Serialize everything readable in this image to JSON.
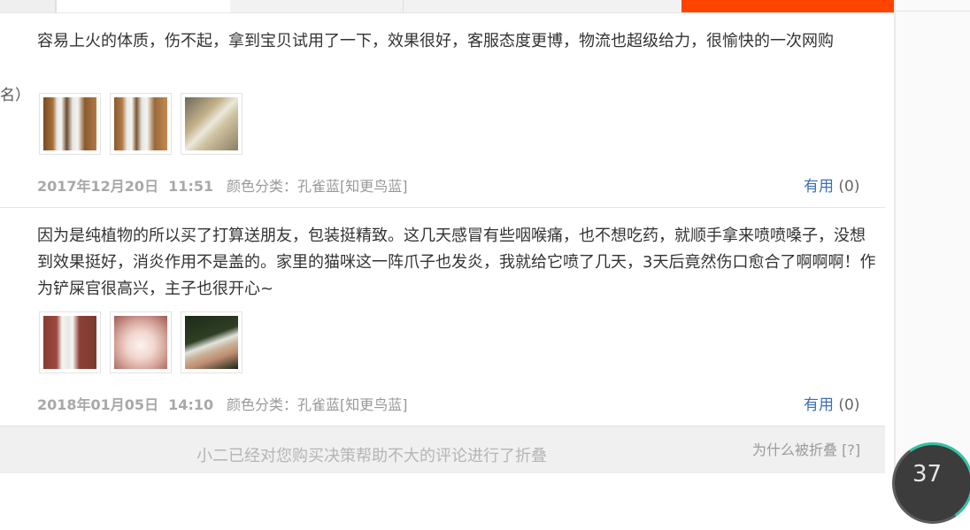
{
  "left_fragment": "名）",
  "reviews": [
    {
      "content": "容易上火的体质，伤不起，拿到宝贝试用了一下，效果很好，客服态度更博，物流也超级给力，很愉快的一次网购",
      "date": "2017年12月20日",
      "time": "11:51",
      "spec": "颜色分类：孔雀蓝[知更鸟蓝]",
      "useful_label": "有用",
      "useful_count": "(0)"
    },
    {
      "content": "因为是纯植物的所以买了打算送朋友，包装挺精致。这几天感冒有些咽喉痛，也不想吃药，就顺手拿来喷喷嗓子，没想到效果挺好，消炎作用不是盖的。家里的猫咪这一阵爪子也发炎，我就给它喷了几天，3天后竟然伤口愈合了啊啊啊！作为铲屎官很高兴，主子也很开心~",
      "date": "2018年01月05日",
      "time": "14:10",
      "spec": "颜色分类：孔雀蓝[知更鸟蓝]",
      "useful_label": "有用",
      "useful_count": "(0)"
    }
  ],
  "folded": {
    "message": "小二已经对您购买决策帮助不大的评论进行了折叠",
    "why": "为什么被折叠 [?]"
  },
  "float_widget": {
    "value": "37"
  }
}
